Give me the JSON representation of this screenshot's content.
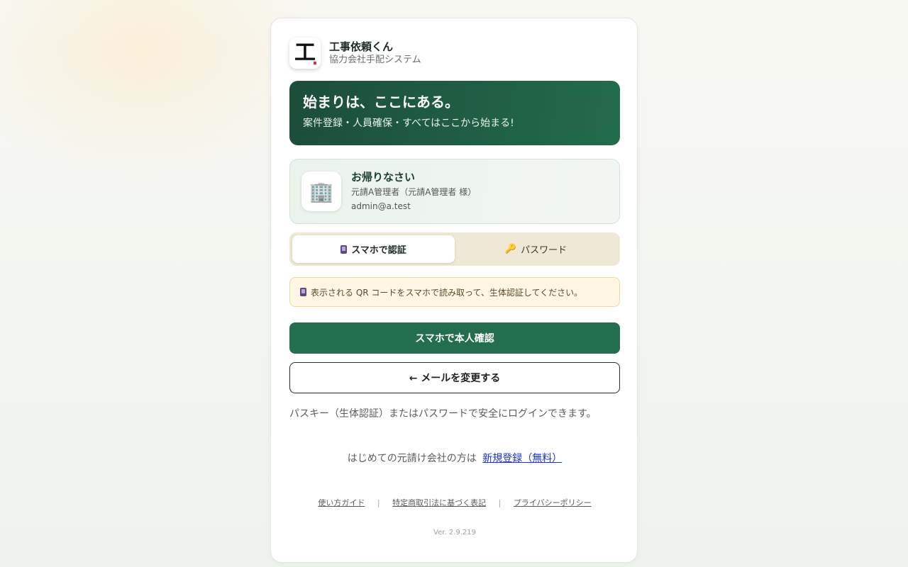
{
  "brand": {
    "logo_char": "工",
    "name": "工事依頼くん",
    "subtitle": "協力会社手配システム"
  },
  "hero": {
    "title": "始まりは、ここにある。",
    "subtitle": "案件登録・人員確保・すべてはここから始まる!"
  },
  "welcome": {
    "avatar_icon": "🏢",
    "title": "お帰りなさい",
    "org": "元請A管理者（元請A管理者 様）",
    "email": "admin@a.test"
  },
  "tabs": [
    {
      "label": "スマホで認証",
      "icon": "phone-icon",
      "active": true
    },
    {
      "label": "パスワード",
      "icon": "key-icon",
      "active": false
    }
  ],
  "notice": {
    "icon": "phone-icon",
    "text": "表示される QR コードをスマホで読み取って、生体認証してください。"
  },
  "actions": {
    "primary_label": "スマホで本人確認",
    "secondary_label": "← メールを変更する"
  },
  "info_text": "パスキー（生体認証）またはパスワードで安全にログインできます。",
  "register": {
    "prompt": "はじめての元請け会社の方は",
    "link_label": "新規登録（無料）"
  },
  "footer": {
    "links": [
      "使い方ガイド",
      "特定商取引法に基づく表記",
      "プライバシーポリシー"
    ],
    "separator": "|"
  },
  "version": "Ver. 2.9.219",
  "colors": {
    "brand_green": "#236e4e",
    "hero_dark": "#1c4d3a",
    "link_blue": "#1a33d6",
    "notice_bg": "#fff7e4"
  }
}
